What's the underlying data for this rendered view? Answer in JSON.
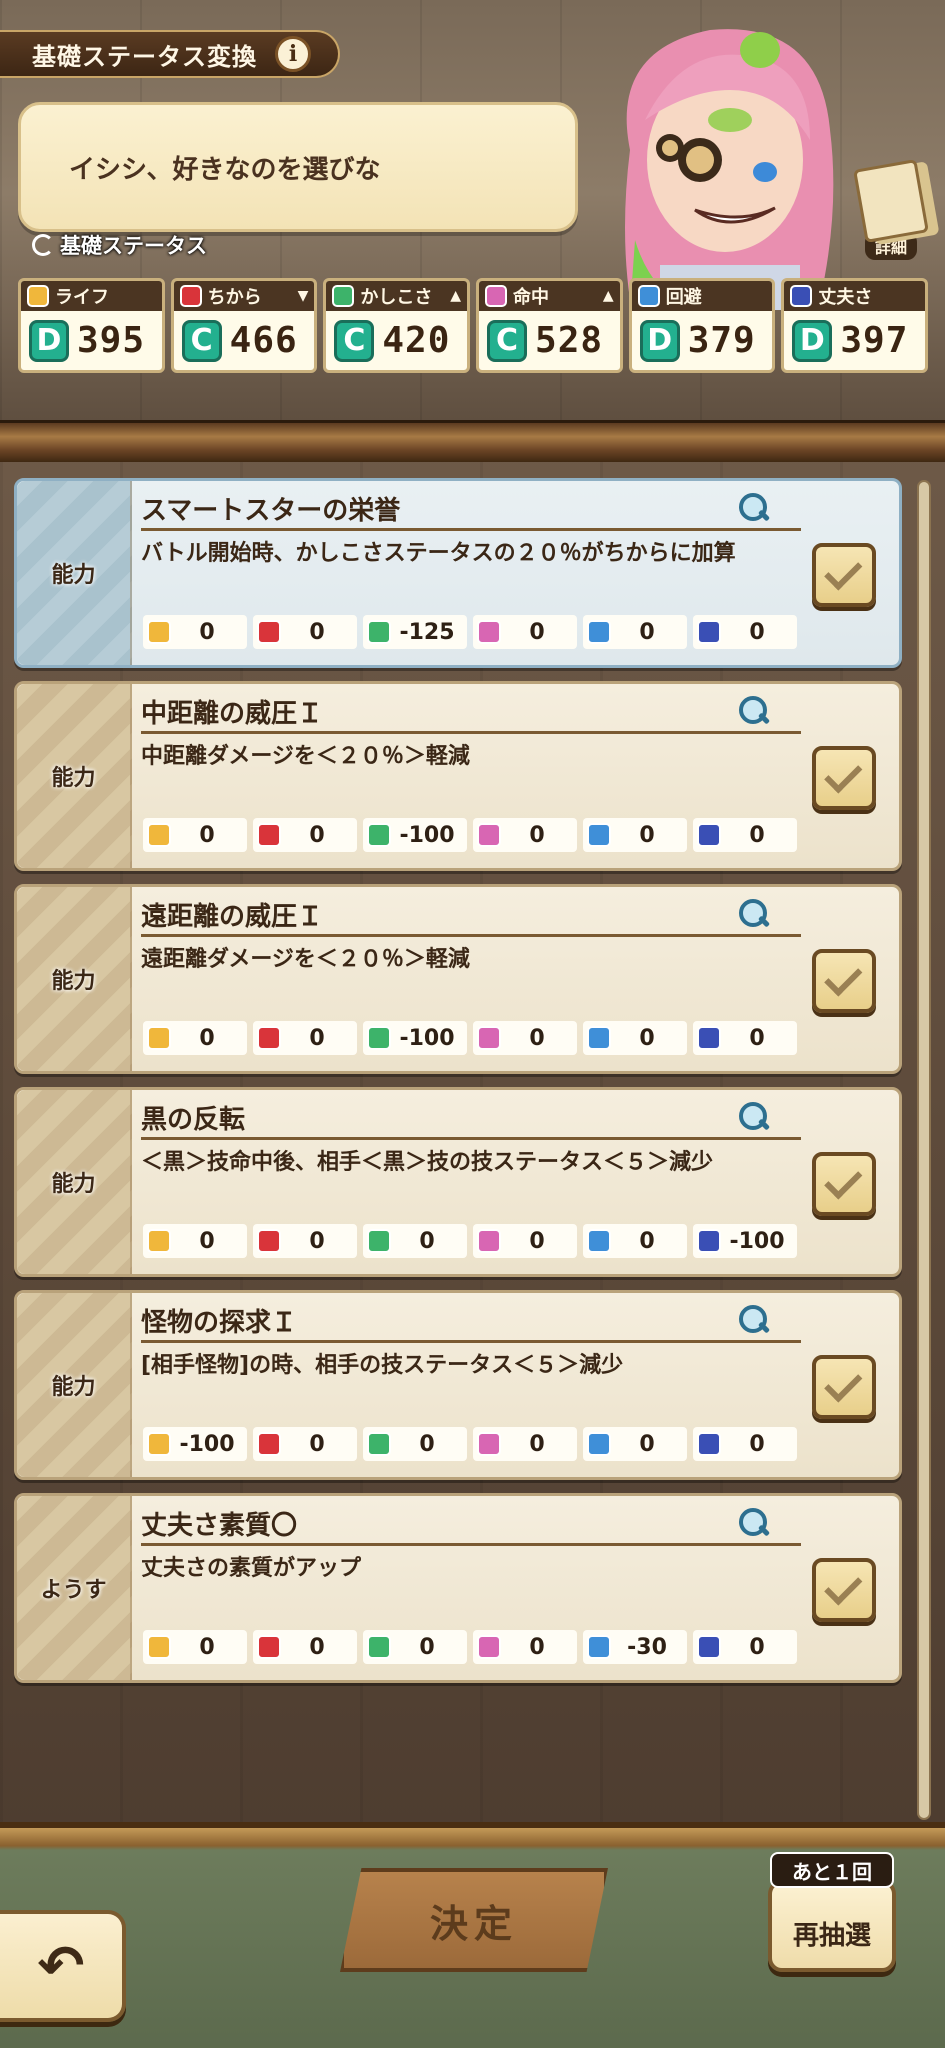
{
  "header": {
    "title": "基礎ステータス変換",
    "info_icon": "i",
    "speech": "イシシ、好きなのを選びな",
    "detail_label": "詳細",
    "basic_stats_label": "基礎ステータス"
  },
  "stats": [
    {
      "name": "ライフ",
      "grade": "D",
      "value": "395",
      "arrow": "",
      "icon": "life-icon",
      "color": "#f0b73b",
      "grade_color": "#23b08f"
    },
    {
      "name": "ちから",
      "grade": "C",
      "value": "466",
      "arrow": "▼",
      "icon": "strength-icon",
      "color": "#d9343a",
      "grade_color": "#23b08f"
    },
    {
      "name": "かしこさ",
      "grade": "C",
      "value": "420",
      "arrow": "▲",
      "icon": "wisdom-icon",
      "color": "#3db36a",
      "grade_color": "#23b08f"
    },
    {
      "name": "命中",
      "grade": "C",
      "value": "528",
      "arrow": "▲",
      "icon": "accuracy-icon",
      "color": "#d866b3",
      "grade_color": "#23b08f"
    },
    {
      "name": "回避",
      "grade": "D",
      "value": "379",
      "arrow": "",
      "icon": "evasion-icon",
      "color": "#3f8fd8",
      "grade_color": "#23b08f"
    },
    {
      "name": "丈夫さ",
      "grade": "D",
      "value": "397",
      "arrow": "",
      "icon": "durability-icon",
      "color": "#3a4fb5",
      "grade_color": "#23b08f"
    }
  ],
  "cards": [
    {
      "kind": "能力",
      "name": "スマートスターの栄誉",
      "desc": "バトル開始時、かしこさステータスの２０％がちからに加算",
      "values": [
        "0",
        "0",
        "-125",
        "0",
        "0",
        "0"
      ],
      "selected": true
    },
    {
      "kind": "能力",
      "name": "中距離の威圧Ｉ",
      "desc": "中距離ダメージを＜２０％＞軽減",
      "values": [
        "0",
        "0",
        "-100",
        "0",
        "0",
        "0"
      ],
      "selected": false
    },
    {
      "kind": "能力",
      "name": "遠距離の威圧Ｉ",
      "desc": "遠距離ダメージを＜２０％＞軽減",
      "values": [
        "0",
        "0",
        "-100",
        "0",
        "0",
        "0"
      ],
      "selected": false
    },
    {
      "kind": "能力",
      "name": "黒の反転",
      "desc": "＜黒＞技命中後、相手＜黒＞技の技ステータス＜５＞減少",
      "values": [
        "0",
        "0",
        "0",
        "0",
        "0",
        "-100"
      ],
      "selected": false
    },
    {
      "kind": "能力",
      "name": "怪物の探求Ｉ",
      "desc": "[相手怪物]の時、相手の技ステータス＜５＞減少",
      "values": [
        "-100",
        "0",
        "0",
        "0",
        "0",
        "0"
      ],
      "selected": false
    },
    {
      "kind": "ようす",
      "name": "丈夫さ素質〇",
      "desc": "丈夫さの素質がアップ",
      "values": [
        "0",
        "0",
        "0",
        "0",
        "-30",
        "0"
      ],
      "selected": false
    }
  ],
  "bottom": {
    "decide_label": "決定",
    "redraw_label": "再抽選",
    "remaining_label": "あと１回",
    "back_icon": "↶"
  }
}
